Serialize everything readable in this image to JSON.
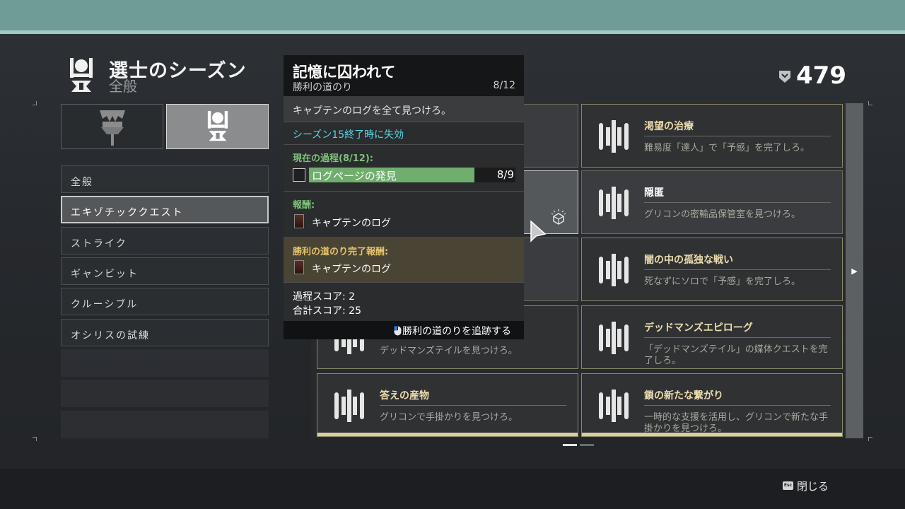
{
  "header": {
    "title": "選士のシーズン",
    "subtitle": "全般",
    "score": "479"
  },
  "sidebar": {
    "items": [
      {
        "label": "全般"
      },
      {
        "label": "エキゾチッククエスト"
      },
      {
        "label": "ストライク"
      },
      {
        "label": "ギャンビット"
      },
      {
        "label": "クルーシブル"
      },
      {
        "label": "オシリスの試練"
      }
    ],
    "active_index": 1
  },
  "cards": [
    {
      "title": "",
      "desc": "デッドマンズテイルを見つけろ。"
    },
    {
      "title": "渇望の治療",
      "desc": "難易度「達人」で「予感」を完了しろ。"
    },
    {
      "title": "隠匿",
      "desc": "グリコンの密輸品保管室を見つけろ。"
    },
    {
      "title": "闇の中の孤独な戦い",
      "desc": "死なずにソロで「予感」を完了しろ。"
    },
    {
      "title": "デッドマンズエピローグ",
      "desc": "「デッドマンズテイル」の媒体クエストを完了しろ。"
    },
    {
      "title": "答えの産物",
      "desc": "グリコンで手掛かりを見つけろ。"
    },
    {
      "title": "鎖の新たな繋がり",
      "desc": "一時的な支援を活用し、グリコンで新たな手掛かりを見つけろ。"
    }
  ],
  "tooltip": {
    "title": "記憶に囚われて",
    "subtitle": "勝利の道のり",
    "count": "8/12",
    "description": "キャプテンのログを全て見つけろ。",
    "expiry": "シーズン15終了時に失効",
    "progress_header": "現在の過程(8/12):",
    "objective": {
      "label": "ログページの発見",
      "value": "8/9",
      "progress": 0.8889
    },
    "rewards_header": "報酬:",
    "reward_item": "キャプテンのログ",
    "completion_header": "勝利の道のり完了報酬:",
    "completion_item": "キャプテンのログ",
    "step_score": "過程スコア: 2",
    "total_score": "合計スコア: 25",
    "track_label": "勝利の道のりを追跡する"
  },
  "footer": {
    "esc_key": "Esc",
    "close_label": "閉じる"
  },
  "colors": {
    "accent_teal": "#6f9c97",
    "progress_green": "#6fae6c",
    "card_title": "#ecdcae",
    "expiry_text": "#56d6e3"
  }
}
